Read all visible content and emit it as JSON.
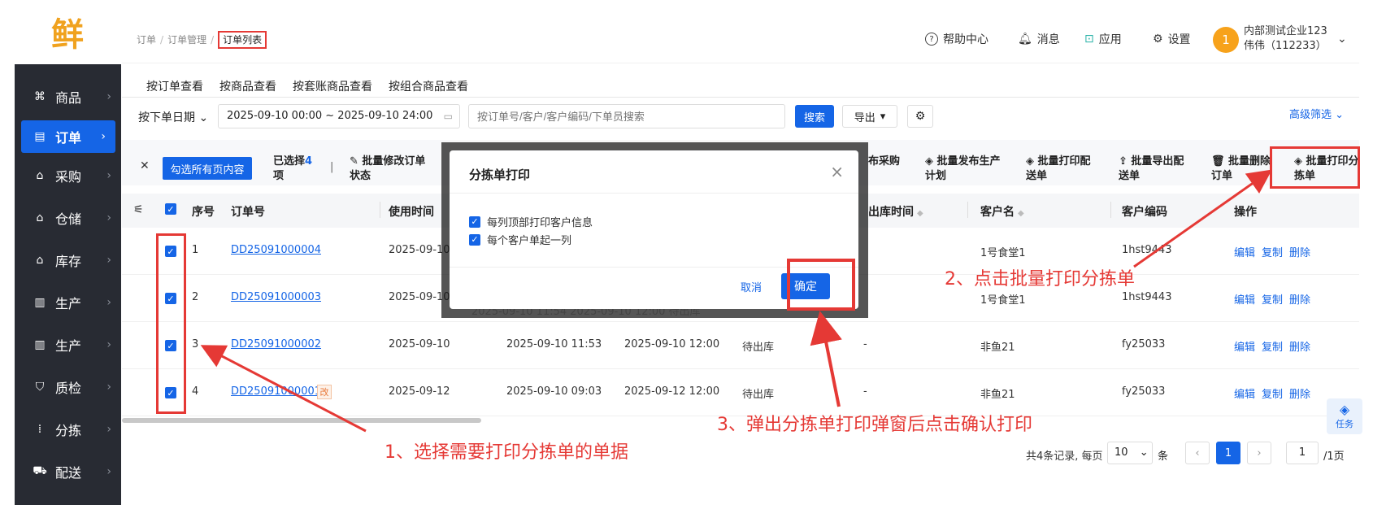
{
  "app": {
    "logo_text": "鲜"
  },
  "breadcrumb": {
    "items": [
      "订单",
      "订单管理"
    ],
    "current": "订单列表"
  },
  "header": {
    "help": "帮助中心",
    "messages": "消息",
    "apps": "应用",
    "settings": "设置",
    "avatar_text": "1",
    "company": "内部测试企业123",
    "user": "伟伟（112233）"
  },
  "sidebar": {
    "items": [
      {
        "label": "商品",
        "icon": "command-icon"
      },
      {
        "label": "订单",
        "icon": "clipboard-icon",
        "active": true
      },
      {
        "label": "采购",
        "icon": "shop-icon"
      },
      {
        "label": "仓储",
        "icon": "warehouse-icon"
      },
      {
        "label": "库存",
        "icon": "warehouse-icon"
      },
      {
        "label": "生产",
        "icon": "factory-icon"
      },
      {
        "label": "生产",
        "icon": "factory-icon"
      },
      {
        "label": "质检",
        "icon": "shield-icon"
      },
      {
        "label": "分拣",
        "icon": "sort-icon"
      },
      {
        "label": "配送",
        "icon": "truck-icon"
      }
    ]
  },
  "tabs": [
    "按订单查看",
    "按商品查看",
    "按套账商品查看",
    "按组合商品查看"
  ],
  "filter": {
    "date_type": "按下单日期",
    "date_range": "2025-09-10 00:00 ~ 2025-09-10 24:00",
    "search_placeholder": "按订单号/客户/客户编码/下单员搜索",
    "search_button": "搜索",
    "export_button": "导出",
    "advanced": "高级筛选"
  },
  "batch": {
    "select_all": "勾选所有页内容",
    "selected_prefix": "已选择",
    "selected_count": "4",
    "selected_suffix": "项",
    "buttons": [
      {
        "label": "批量修改订单\n状态"
      },
      {
        "label": "布采购"
      },
      {
        "label": "批量发布生产\n计划"
      },
      {
        "label": "批量打印配\n送单"
      },
      {
        "label": "批量导出配\n送单"
      },
      {
        "label": "批量删除\n订单"
      },
      {
        "label": "批量打印分\n拣单"
      }
    ]
  },
  "table": {
    "headers": {
      "seq": "序号",
      "order_no": "订单号",
      "use_time": "使用时间",
      "out_time": "出库时间",
      "customer": "客户名",
      "customer_code": "客户编码",
      "ops": "操作"
    },
    "rows": [
      {
        "seq": "1",
        "order_no": "DD25091000004",
        "use_time": "2025-09-10",
        "order_time": "",
        "delivery_time": "",
        "status": "",
        "out_time": "",
        "customer": "1号食堂1",
        "code": "1hst9443",
        "tag": ""
      },
      {
        "seq": "2",
        "order_no": "DD25091000003",
        "use_time": "2025-09-10",
        "order_time": "",
        "delivery_time": "",
        "status": "",
        "out_time": "",
        "customer": "1号食堂1",
        "code": "1hst9443",
        "tag": ""
      },
      {
        "seq": "3",
        "order_no": "DD25091000002",
        "use_time": "2025-09-10",
        "order_time": "2025-09-10 11:53",
        "delivery_time": "2025-09-10 12:00",
        "status": "待出库",
        "out_time": "-",
        "customer": "非鱼21",
        "code": "fy25033",
        "tag": ""
      },
      {
        "seq": "4",
        "order_no": "DD25091000001",
        "use_time": "2025-09-12",
        "order_time": "2025-09-10 09:03",
        "delivery_time": "2025-09-12 12:00",
        "status": "待出库",
        "out_time": "-",
        "customer": "非鱼21",
        "code": "fy25033",
        "tag": "改"
      }
    ],
    "ops": [
      "编辑",
      "复制",
      "删除"
    ],
    "masked_text": "2025-09-10 11:54     2025-09-10 12:00     待出库"
  },
  "pagination": {
    "total": "共4条记录, 每页",
    "page_size": "10",
    "unit": "条",
    "current": "1",
    "page_input": "1",
    "of_pages": "/1页"
  },
  "task_float": {
    "label": "任务"
  },
  "modal": {
    "title": "分拣单打印",
    "options": [
      "每列顶部打印客户信息",
      "每个客户单起一列"
    ],
    "cancel": "取消",
    "confirm": "确定"
  },
  "annotations": {
    "step1": "1、选择需要打印分拣单的单据",
    "step2": "2、点击批量打印分拣单",
    "step3": "3、弹出分拣单打印弹窗后点击确认打印"
  },
  "colors": {
    "primary": "#1565e6",
    "annotation": "#e53935",
    "sidebar": "#282b33",
    "logo": "#f0a21f"
  }
}
